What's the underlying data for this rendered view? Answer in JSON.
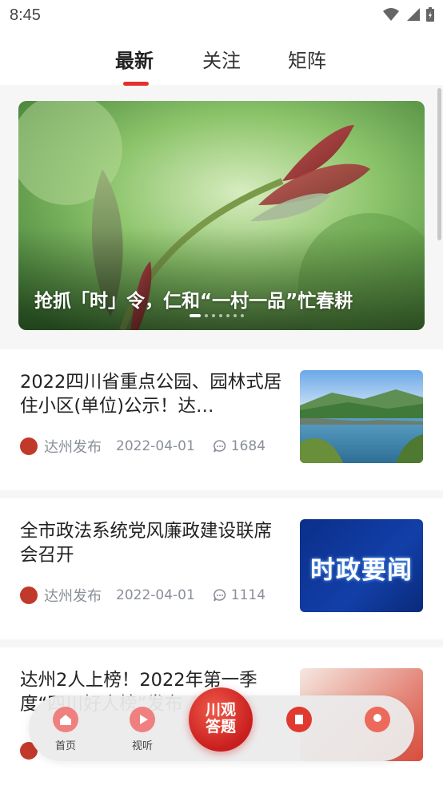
{
  "status_bar": {
    "time": "8:45"
  },
  "tabs": [
    {
      "label": "最新",
      "active": true
    },
    {
      "label": "关注",
      "active": false
    },
    {
      "label": "矩阵",
      "active": false
    }
  ],
  "banner": {
    "caption": "抢抓「时」令，仁和“一村一品”忙春耕",
    "dots_count": 7,
    "active_dot": 1
  },
  "articles": [
    {
      "title": "2022四川省重点公园、园林式居住小区(单位)公示！达…",
      "source": "达州发布",
      "date": "2022-04-01",
      "comments": "1684",
      "thumb": "lake-landscape"
    },
    {
      "title": "全市政法系统党风廉政建设联席会召开",
      "source": "达州发布",
      "date": "2022-04-01",
      "comments": "1114",
      "thumb_text": "时政要闻"
    },
    {
      "title": "达州2人上榜！2022年第一季度“四川好人榜”发布",
      "source": "达州发布",
      "date": "",
      "comments": ""
    }
  ],
  "bottom_nav": {
    "home": "首页",
    "video": "视听",
    "center_line1": "川观",
    "center_line2": "答题"
  },
  "colors": {
    "accent": "#e3322e",
    "meta": "#8a8f99"
  }
}
